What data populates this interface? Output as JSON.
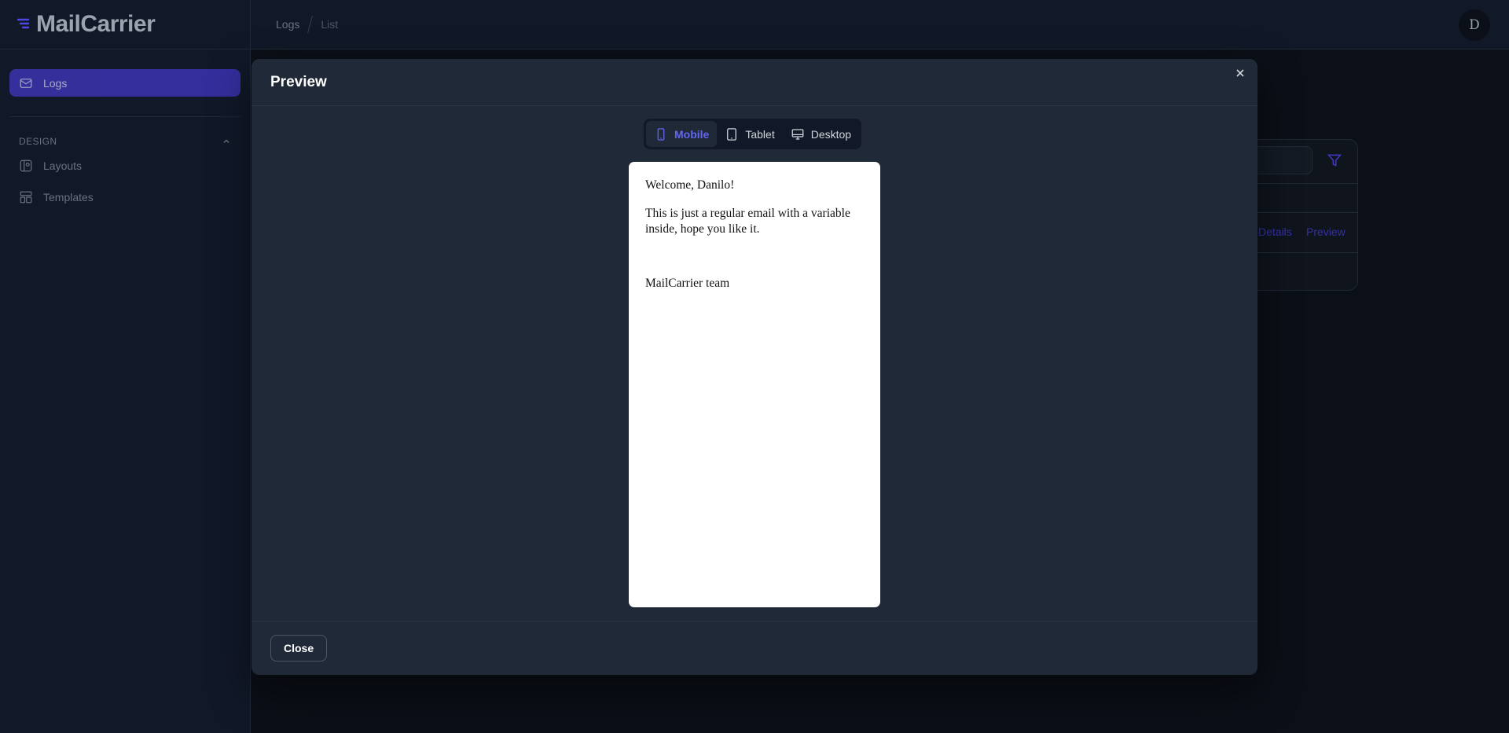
{
  "app": {
    "brand": "MailCarrier"
  },
  "sidebar": {
    "items": [
      {
        "label": "Logs",
        "icon": "mail-icon",
        "active": true
      }
    ],
    "group": {
      "title": "DESIGN",
      "items": [
        {
          "label": "Layouts",
          "icon": "layouts-icon"
        },
        {
          "label": "Templates",
          "icon": "templates-icon"
        }
      ]
    }
  },
  "topbar": {
    "breadcrumb": [
      "Logs",
      "List"
    ],
    "avatar_initial": "D"
  },
  "background": {
    "links": [
      "Details",
      "Preview"
    ]
  },
  "modal": {
    "title": "Preview",
    "devices": [
      {
        "label": "Mobile",
        "icon": "mobile-icon",
        "active": true
      },
      {
        "label": "Tablet",
        "icon": "tablet-icon",
        "active": false
      },
      {
        "label": "Desktop",
        "icon": "desktop-icon",
        "active": false
      }
    ],
    "email": {
      "greeting": "Welcome, Danilo!",
      "body": "This is just a regular email with a variable inside, hope you like it.",
      "signature": "MailCarrier team"
    },
    "close_label": "Close"
  },
  "colors": {
    "accent": "#6366f1",
    "active_nav": "#4338ca",
    "modal_bg": "#1f2937",
    "page_bg": "#0b0f17"
  }
}
